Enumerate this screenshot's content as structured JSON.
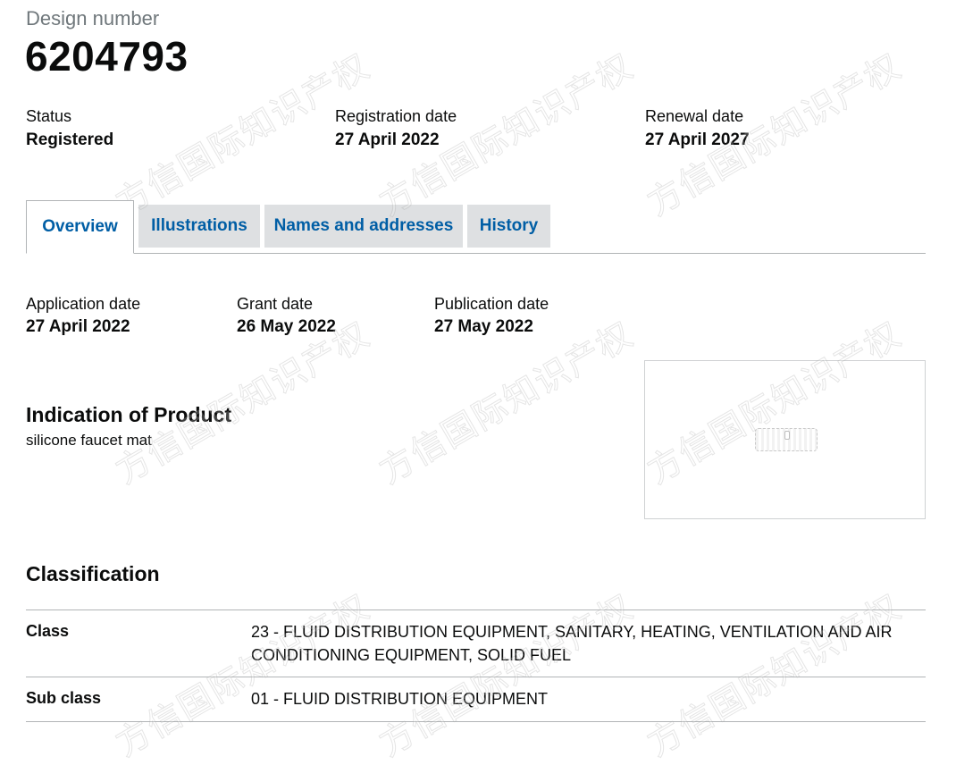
{
  "header": {
    "caption": "Design number",
    "number": "6204793"
  },
  "summary": {
    "status_label": "Status",
    "status_value": "Registered",
    "registration_label": "Registration date",
    "registration_value": "27 April 2022",
    "renewal_label": "Renewal date",
    "renewal_value": "27 April 2027"
  },
  "tabs": [
    {
      "label": "Overview",
      "active": true
    },
    {
      "label": "Illustrations",
      "active": false
    },
    {
      "label": "Names and addresses",
      "active": false
    },
    {
      "label": "History",
      "active": false
    }
  ],
  "overview": {
    "application_label": "Application date",
    "application_value": "27 April 2022",
    "grant_label": "Grant date",
    "grant_value": "26 May 2022",
    "publication_label": "Publication date",
    "publication_value": "27 May 2022",
    "indication_heading": "Indication of Product",
    "indication_text": "silicone faucet mat"
  },
  "classification": {
    "heading": "Classification",
    "rows": [
      {
        "key": "Class",
        "value": "23 - FLUID DISTRIBUTION EQUIPMENT, SANITARY, HEATING, VENTILATION AND AIR CONDITIONING EQUIPMENT, SOLID FUEL"
      },
      {
        "key": "Sub class",
        "value": "01 - FLUID DISTRIBUTION EQUIPMENT"
      }
    ]
  },
  "watermark_text": "方信国际知识产权",
  "colors": {
    "link": "#005ea5",
    "tab_bg": "#dee0e2",
    "border": "#b1b4b6"
  }
}
